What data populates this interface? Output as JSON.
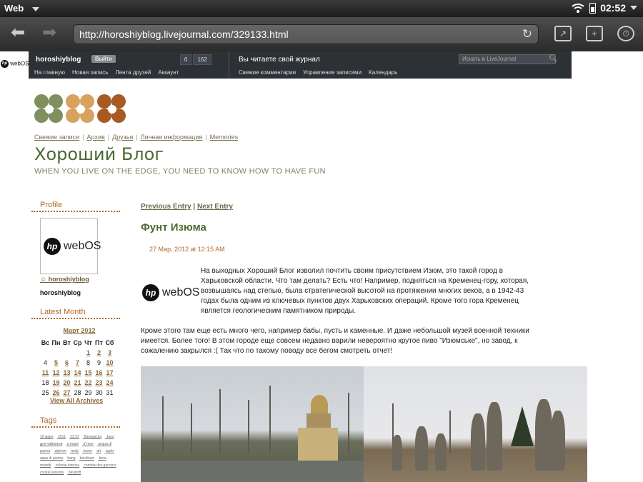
{
  "status": {
    "app": "Web",
    "time": "02:52"
  },
  "browser": {
    "url": "http://horoshiyblog.livejournal.com/329133.html"
  },
  "ljbar": {
    "username": "horoshiyblog",
    "logout": "Выйти",
    "count1": "0",
    "count2": "162",
    "nav": [
      "На главную",
      "Новая запись",
      "Лента друзей",
      "Аккаунт"
    ],
    "reading": "Вы читаете свой журнал",
    "links": [
      "Свежие комментарии",
      "Управление записями",
      "Календарь"
    ],
    "search_placeholder": "Искать в LiveJournal"
  },
  "logo_small": {
    "mark": "hp",
    "text": "webOS"
  },
  "blog": {
    "links": [
      "Свежие записи",
      "Архив",
      "Друзья",
      "Личная информация",
      "Memories"
    ],
    "title": "Хороший Блог",
    "subtitle": "WHEN YOU LIVE ON THE EDGE, YOU NEED TO KNOW HOW TO HAVE FUN",
    "flower_colors": [
      "#7f8f5e",
      "#d7a25f",
      "#a85a24"
    ]
  },
  "sidebar": {
    "profile_head": "Profile",
    "userpic_mark": "hp",
    "userpic_text": "webOS",
    "profile_user": "horoshiyblog",
    "profile_name": "horoshiyblog",
    "latest_head": "Latest Month",
    "month": "Март 2012",
    "days": [
      "Вс",
      "Пн",
      "Вт",
      "Ср",
      "Чт",
      "Пт",
      "Сб"
    ],
    "weeks": [
      [
        [
          "",
          0
        ],
        [
          "",
          0
        ],
        [
          "",
          0
        ],
        [
          "",
          0
        ],
        [
          "1",
          1
        ],
        [
          "2",
          1
        ],
        [
          "3",
          1
        ]
      ],
      [
        [
          "4",
          0
        ],
        [
          "5",
          1
        ],
        [
          "6",
          1
        ],
        [
          "7",
          1
        ],
        [
          "8",
          0
        ],
        [
          "9",
          0
        ],
        [
          "10",
          1
        ]
      ],
      [
        [
          "11",
          1
        ],
        [
          "12",
          1
        ],
        [
          "13",
          1
        ],
        [
          "14",
          1
        ],
        [
          "15",
          1
        ],
        [
          "16",
          1
        ],
        [
          "17",
          1
        ]
      ],
      [
        [
          "18",
          0
        ],
        [
          "19",
          1
        ],
        [
          "20",
          1
        ],
        [
          "21",
          1
        ],
        [
          "22",
          1
        ],
        [
          "23",
          1
        ],
        [
          "24",
          1
        ]
      ],
      [
        [
          "25",
          0
        ],
        [
          "26",
          1
        ],
        [
          "27",
          1
        ],
        [
          "28",
          0
        ],
        [
          "29",
          0
        ],
        [
          "30",
          0
        ],
        [
          "31",
          0
        ]
      ]
    ],
    "view_all": "View All Archives",
    "tags_head": "Tags",
    "tags": [
      "10 марe",
      "2011",
      "23:23",
      "Вапедасkа",
      "Java для чайников",
      "a maze",
      "a\"mee",
      "acqua di parma",
      "alphom",
      "andy",
      "baxer",
      "art",
      "apple",
      "aqua di parma",
      "bang",
      "beckham",
      "birra moretti",
      "colonia intensa",
      "comma des garcons",
      "crystal serenity",
      "davidoff"
    ]
  },
  "entry": {
    "prev": "Previous Entry",
    "sep": "|",
    "next": "Next Entry",
    "title": "Фунт Изюма",
    "date": "27 Мар, 2012 at 12:15 AM",
    "logo_mark": "hp",
    "logo_text": "webOS",
    "para1": "На выходных Хороший Блог изволил почтить своим присутствием Изюм, это такой город в Харьковской области. Что там делать? Есть что! Например, подняться на Кременец-гору, которая, возвышаясь над степью, была стратегической высотой на протяжении многих веков, а в 1942-43 годах была одним из ключевых пунктов двух Харьковских операций. Кроме того гора Кременец является геологическим памятником природы.",
    "para2": "Кроме этого там еще есть много чего, например бабы, пусть и каменные. И даже небольшой музей военной техники имеется. Более того! В этом городе еще совсем недавно варили невероятно крутое пиво \"Изюмське\", но завод, к сожалению закрылся :( Так что по такому поводу все бегом смотреть отчет!"
  }
}
